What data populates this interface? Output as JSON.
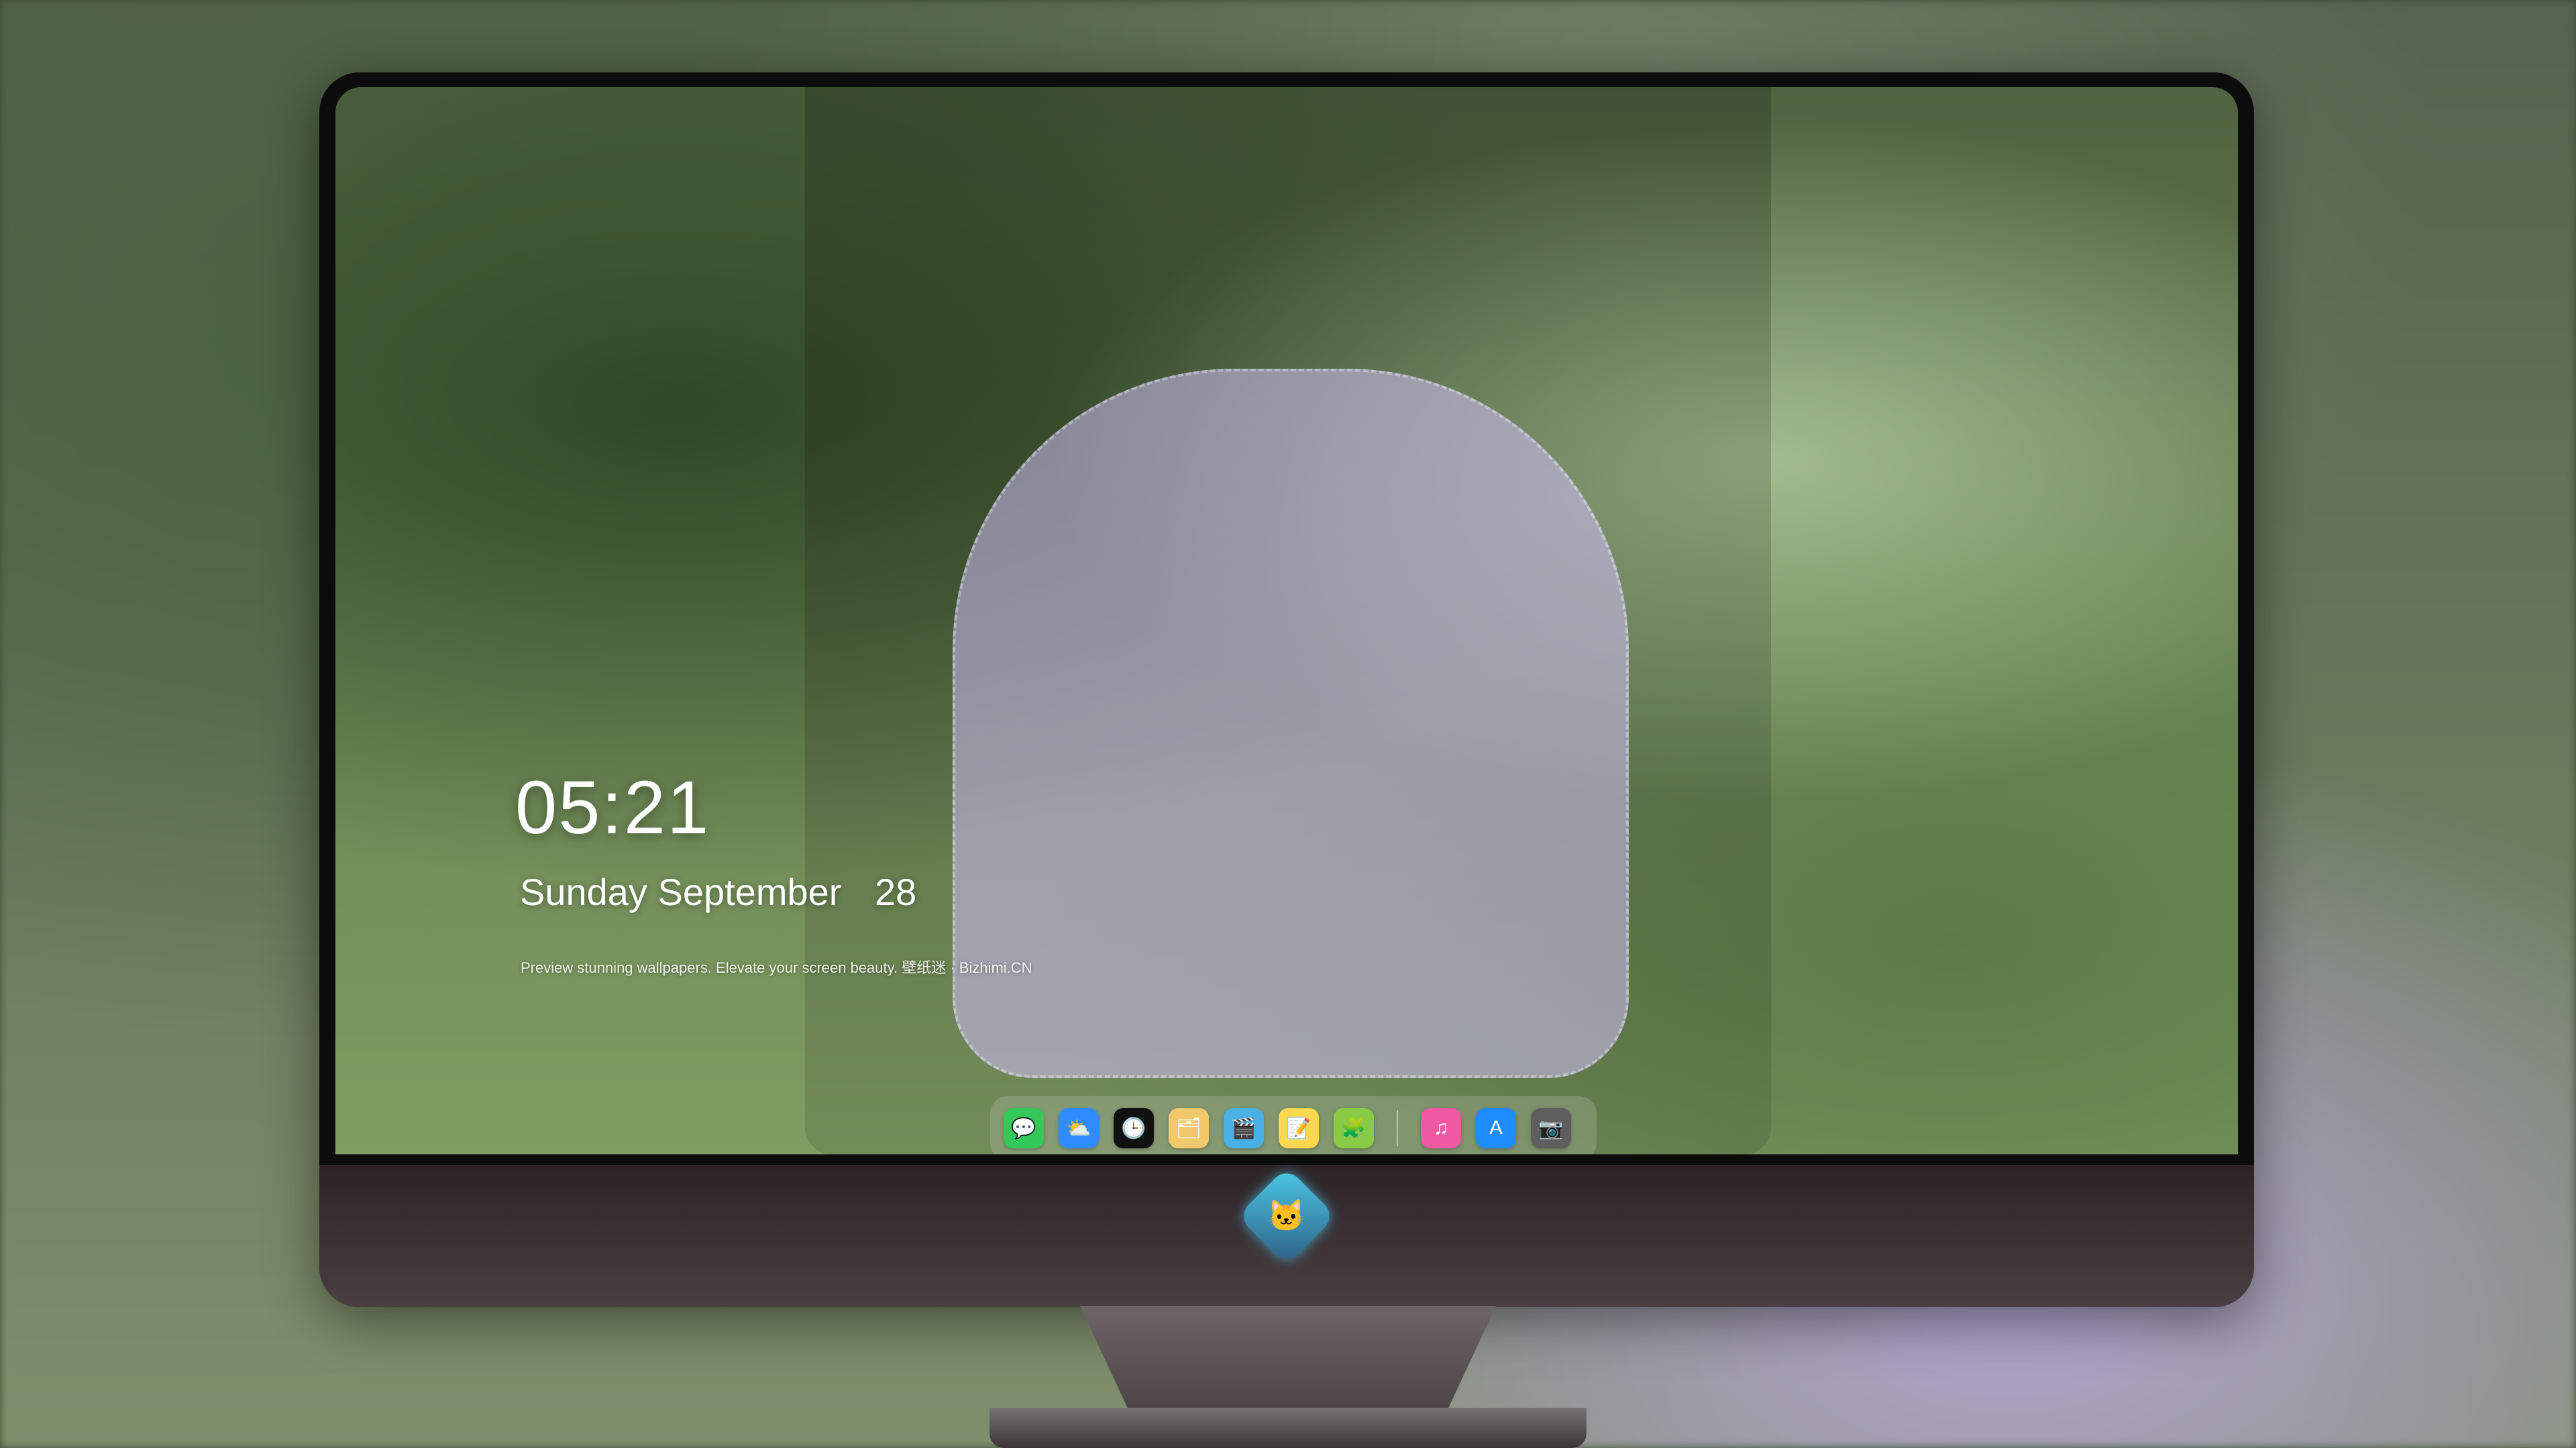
{
  "lockscreen": {
    "time": "05:21",
    "date_label": "Sunday September",
    "date_day": "28",
    "tagline": "Preview stunning wallpapers. Elevate your screen beauty. 壁纸迷 · Bizhimi.CN"
  },
  "dock": {
    "items": [
      {
        "name": "messages",
        "icon": "speech-bubble-icon",
        "color": "#34c759"
      },
      {
        "name": "weather",
        "icon": "cloud-sun-icon",
        "color": "#2f8cff"
      },
      {
        "name": "clock",
        "icon": "clock-icon",
        "color": "#111111"
      },
      {
        "name": "preview",
        "icon": "image-folder-icon",
        "color": "#f0c96c"
      },
      {
        "name": "clips",
        "icon": "clapper-board-icon",
        "color": "#4ab1e6"
      },
      {
        "name": "notes",
        "icon": "notes-icon",
        "color": "#ffd84f"
      },
      {
        "name": "photo-booth",
        "icon": "photo-grid-icon",
        "color": "#8acb45"
      },
      {
        "name": "music",
        "icon": "music-note-icon",
        "color": "#f05aa4"
      },
      {
        "name": "app-store",
        "icon": "app-store-icon",
        "color": "#1e8cff"
      },
      {
        "name": "camera",
        "icon": "camera-icon",
        "color": "#5e5e5e"
      }
    ]
  },
  "monitor": {
    "logo": "cat-mascot-icon"
  }
}
